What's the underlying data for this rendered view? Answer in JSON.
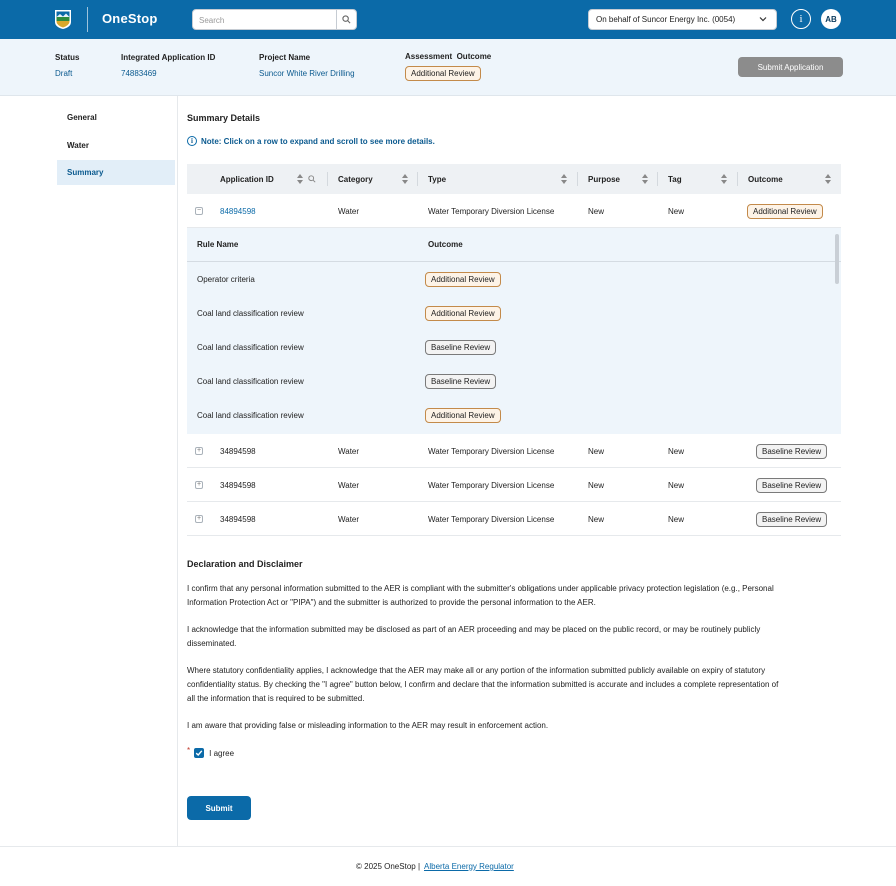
{
  "topbar": {
    "brand": "OneStop",
    "search_placeholder": "Search",
    "behalf": "On behalf of Suncor Energy Inc. (0054)",
    "info_icon_label": "i",
    "avatar_initials": "AB",
    "bg_color": "#0b6aa8"
  },
  "header": {
    "status_label": "Status",
    "status_value": "Draft",
    "app_id_label": "Integrated Application ID",
    "app_id_value": "74883469",
    "project_label": "Project Name",
    "project_value": "Suncor White River Drilling",
    "outcome_label": "Assessment  Outcome",
    "outcome_value": "Additional Review",
    "submit_label": "Submit Application"
  },
  "sidebar": {
    "items": [
      {
        "label": "General"
      },
      {
        "label": "Water"
      },
      {
        "label": "Summary"
      }
    ]
  },
  "summary": {
    "title": "Summary Details",
    "note": "Note: Click on a row to expand and scroll to see more details.",
    "columns": [
      "Application ID",
      "Category",
      "Type",
      "Purpose",
      "Tag",
      "Outcome"
    ],
    "rows": [
      {
        "toggle": "−",
        "id": "84894598",
        "category": "Water",
        "type": "Water Temporary Diversion License",
        "purpose": "New",
        "tag": "New",
        "outcome": "Additional Review"
      },
      {
        "toggle": "+",
        "id": "34894598",
        "category": "Water",
        "type": "Water Temporary Diversion License",
        "purpose": "New",
        "tag": "New",
        "outcome": "Baseline Review"
      },
      {
        "toggle": "+",
        "id": "34894598",
        "category": "Water",
        "type": "Water Temporary Diversion License",
        "purpose": "New",
        "tag": "New",
        "outcome": "Baseline Review"
      },
      {
        "toggle": "+",
        "id": "34894598",
        "category": "Water",
        "type": "Water Temporary Diversion License",
        "purpose": "New",
        "tag": "New",
        "outcome": "Baseline Review"
      }
    ],
    "sub_columns": [
      "Rule Name",
      "Outcome"
    ],
    "sub_rows": [
      {
        "rule": "Operator criteria",
        "outcome": "Additional Review"
      },
      {
        "rule": "Coal land classification review",
        "outcome": "Additional Review"
      },
      {
        "rule": "Coal land classification review",
        "outcome": "Baseline Review"
      },
      {
        "rule": "Coal land classification review",
        "outcome": "Baseline Review"
      },
      {
        "rule": "Coal land classification review",
        "outcome": "Additional Review"
      }
    ]
  },
  "declaration": {
    "title": "Declaration and Disclaimer",
    "p1": "I confirm that any personal information submitted to the AER is compliant with the submitter's obligations under applicable privacy protection legislation (e.g., Personal Information Protection Act or \"PIPA\") and the submitter is authorized to provide the personal information to the AER.",
    "p2": "I acknowledge that the information submitted may be disclosed as part of an AER proceeding and may be placed on the public record, or may be routinely publicly disseminated.",
    "p3": "Where statutory confidentiality applies, I acknowledge that the AER may make all or any portion of the information submitted publicly available on expiry of statutory confidentiality status. By checking the \"I agree\" button below, I confirm and declare that the information submitted is accurate and includes a complete representation of all the information that is required to be submitted.",
    "p4": "I am aware that providing false or misleading information to the AER may result in enforcement action.",
    "required_mark": "*",
    "agree_label": "I agree",
    "submit_label": "Submit"
  },
  "footer": {
    "copyright": "© 2025 OneStop |",
    "link": "Alberta Energy Regulator"
  }
}
